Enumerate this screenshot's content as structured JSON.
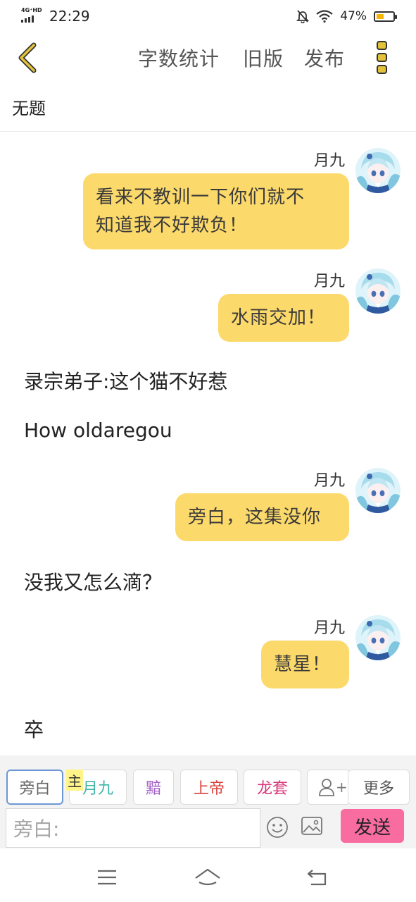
{
  "status": {
    "network": "4G⁺HD",
    "time": "22:29",
    "battery_pct": "47%",
    "battery_level": 0.47
  },
  "topbar": {
    "word_count": "字数统计",
    "old_version": "旧版",
    "publish": "发布"
  },
  "title": "无题",
  "messages": [
    {
      "type": "bubble",
      "speaker": "月九",
      "lines": [
        "看来不教训一下你们就不",
        "知道我不好欺负！"
      ]
    },
    {
      "type": "bubble",
      "speaker": "月九",
      "lines": [
        "水雨交加！"
      ]
    },
    {
      "type": "narration",
      "text": "录宗弟子:这个猫不好惹"
    },
    {
      "type": "narration",
      "text": "How oldaregou"
    },
    {
      "type": "bubble",
      "speaker": "月九",
      "lines": [
        "旁白，这集没你"
      ]
    },
    {
      "type": "narration",
      "text": "没我又怎么滴？"
    },
    {
      "type": "bubble",
      "speaker": "月九",
      "lines": [
        "慧星！"
      ]
    },
    {
      "type": "narration",
      "text": "卒"
    }
  ],
  "toolbar": {
    "chips": [
      {
        "label": "旁白",
        "color": "#666666",
        "selected": true
      },
      {
        "label": "月九",
        "color": "#3fb6a8",
        "selected": false
      },
      {
        "label": "黯",
        "color": "#a45fc9",
        "selected": false
      },
      {
        "label": "上帝",
        "color": "#d9413c",
        "selected": false
      },
      {
        "label": "龙套",
        "color": "#d9387a",
        "selected": false
      }
    ],
    "main_badge": "主",
    "add_role_symbol": "+",
    "more_label": "更多",
    "input_placeholder": "旁白:",
    "send_label": "发送"
  },
  "colors": {
    "bubble": "#fcd96b",
    "accent_yellow": "#e2c23a",
    "send": "#f86ca0"
  }
}
